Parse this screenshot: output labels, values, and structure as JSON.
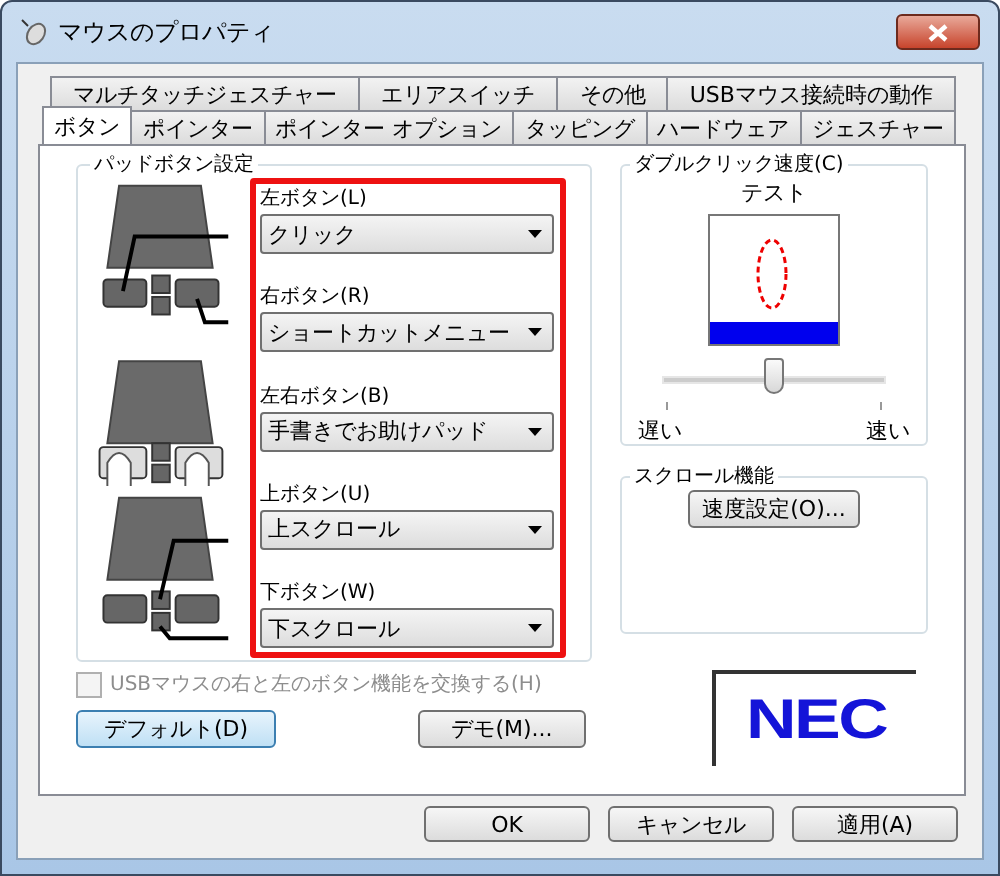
{
  "window": {
    "title": "マウスのプロパティ"
  },
  "tabs_back": [
    {
      "label": "マルチタッチジェスチャー",
      "selected": false
    },
    {
      "label": "エリアスイッチ",
      "selected": false
    },
    {
      "label": "その他",
      "selected": false
    },
    {
      "label": "USBマウス接続時の動作",
      "selected": false
    }
  ],
  "tabs_front": [
    {
      "label": "ボタン",
      "selected": true
    },
    {
      "label": "ポインター",
      "selected": false
    },
    {
      "label": "ポインター オプション",
      "selected": false
    },
    {
      "label": "タッピング",
      "selected": false
    },
    {
      "label": "ハードウェア",
      "selected": false
    },
    {
      "label": "ジェスチャー",
      "selected": false
    }
  ],
  "pad_buttons": {
    "title": "パッドボタン設定",
    "settings": [
      {
        "label": "左ボタン(L)",
        "value": "クリック"
      },
      {
        "label": "右ボタン(R)",
        "value": "ショートカットメニュー"
      },
      {
        "label": "左右ボタン(B)",
        "value": "手書きでお助けパッド"
      },
      {
        "label": "上ボタン(U)",
        "value": "上スクロール"
      },
      {
        "label": "下ボタン(W)",
        "value": "下スクロール"
      }
    ]
  },
  "double_click": {
    "title": "ダブルクリック速度(C)",
    "test_label": "テスト",
    "level": 0.5,
    "slow": "遅い",
    "fast": "速い"
  },
  "scroll": {
    "title": "スクロール機能",
    "button": "速度設定(O)..."
  },
  "swap_checkbox": {
    "label": "USBマウスの右と左のボタン機能を交換する(H)",
    "checked": false,
    "disabled": true
  },
  "default_button": "デフォルト(D)",
  "demo_button": "デモ(M)...",
  "logo": "NEC",
  "buttons": [
    "OK",
    "キャンセル",
    "適用(A)"
  ]
}
